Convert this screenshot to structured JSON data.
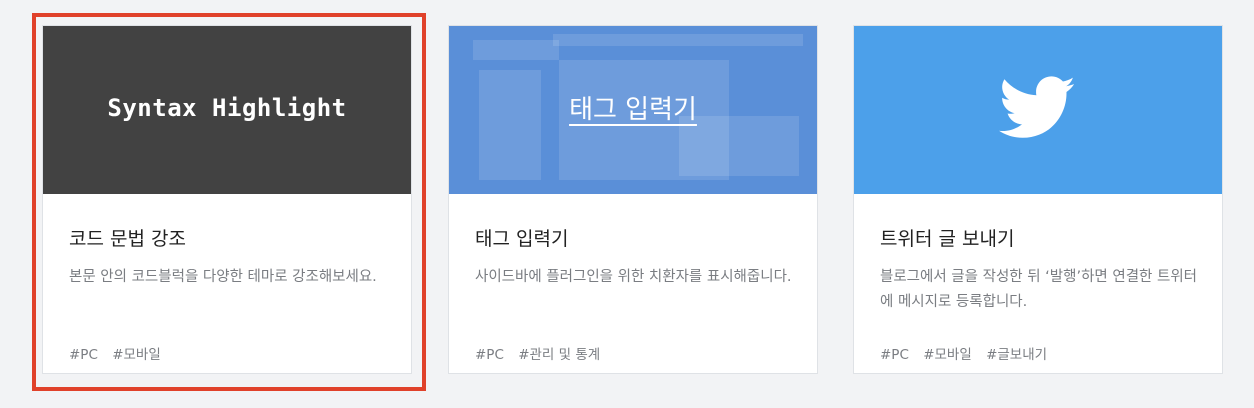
{
  "cards": [
    {
      "thumbnail_text": "Syntax Highlight",
      "title": "코드 문법 강조",
      "description": "본문 안의 코드블럭을 다양한 테마로 강조해보세요.",
      "tags": [
        "#PC",
        "#모바일"
      ],
      "selected": true
    },
    {
      "thumbnail_text": "태그 입력기",
      "title": "태그 입력기",
      "description": "사이드바에 플러그인을 위한 치환자를 표시해줍니다.",
      "tags": [
        "#PC",
        "#관리 및 통계"
      ]
    },
    {
      "thumbnail_icon": "twitter-bird-icon",
      "title": "트위터 글 보내기",
      "description": "블로그에서 글을 작성한 뒤 ‘발행’하면 연결한 트위터에 메시지로 등록합니다.",
      "tags": [
        "#PC",
        "#모바일",
        "#글보내기"
      ]
    }
  ],
  "colors": {
    "selection_outline": "#e0412a",
    "dark_thumbnail": "#424242",
    "blue_thumbnail": "#5a8fd8",
    "twitter_thumbnail": "#4ca0ea"
  }
}
